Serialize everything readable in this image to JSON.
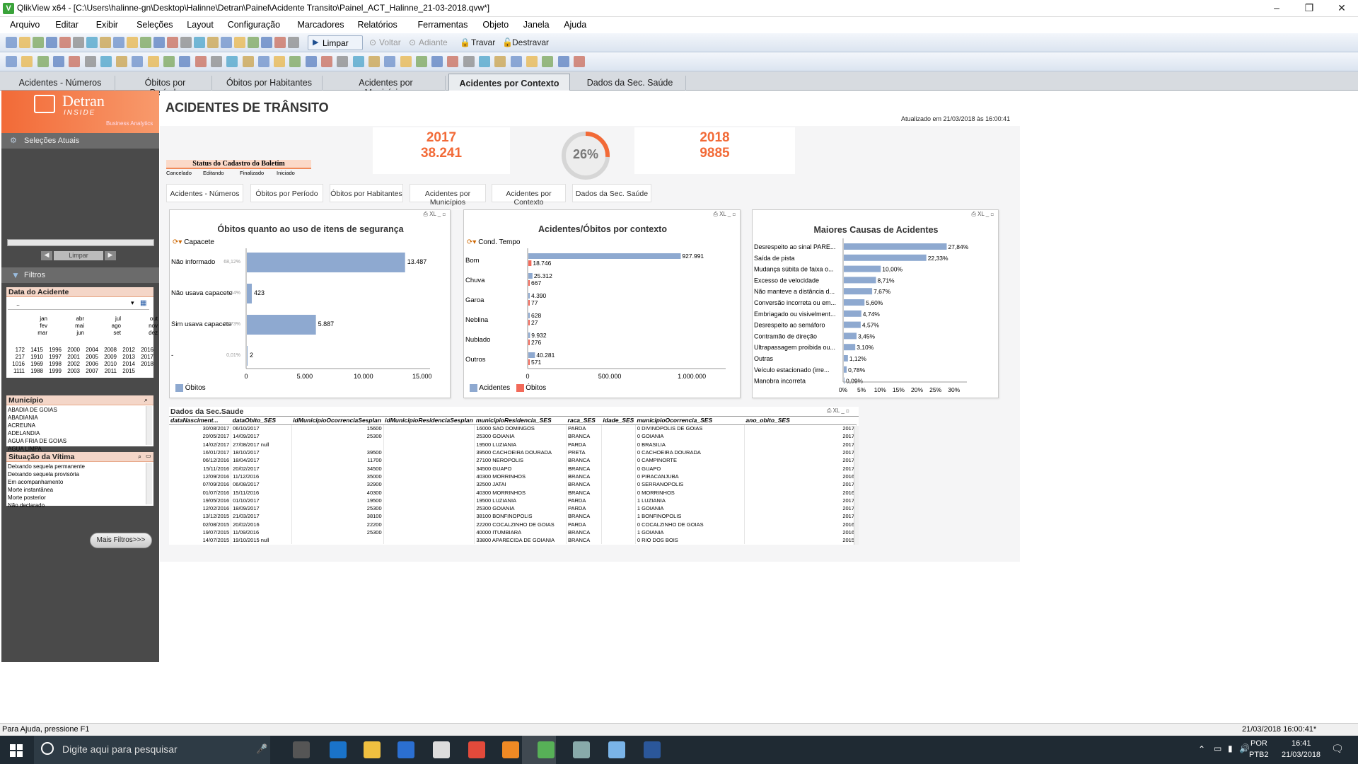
{
  "window": {
    "title": "QlikView x64 - [C:\\Users\\halinne-gn\\Desktop\\Halinne\\Detran\\Painel\\Acidente Transito\\Painel_ACT_Halinne_21-03-2018.qvw*]",
    "minimize": "–",
    "restore": "❐",
    "close": "✕"
  },
  "menu": [
    "Arquivo",
    "Editar",
    "Exibir",
    "Seleções",
    "Layout",
    "Configuração",
    "Marcadores",
    "Relatórios",
    "Ferramentas",
    "Objeto",
    "Janela",
    "Ajuda"
  ],
  "toolbar": {
    "limpar": "Limpar",
    "voltar": "Voltar",
    "adiante": "Adiante",
    "travar": "Travar",
    "destravar": "Destravar"
  },
  "tabs": [
    "Acidentes - Números",
    "Óbitos por Período",
    "Óbitos por Habitantes",
    "Acidentes por Municípios",
    "Acidentes por Contexto",
    "Dados da Sec. Saúde"
  ],
  "active_tab": "Acidentes por Contexto",
  "sidebar": {
    "logo_main": "Detran",
    "logo_sub": "INSIDE",
    "logo_tag": "Business Analytics",
    "selecoes": "Seleções Atuais",
    "limpar": "Limpar",
    "filtros": "Filtros",
    "mais_filtros": "Mais Filtros>>>"
  },
  "data_acidente": {
    "title": "Data do Acidente",
    "value": "..",
    "months": [
      [
        "jan",
        "fev",
        "mar"
      ],
      [
        "abr",
        "mai",
        "jun"
      ],
      [
        "jul",
        "ago",
        "set"
      ],
      [
        "out",
        "nov",
        "dez"
      ]
    ],
    "years": [
      [
        "172",
        "1415",
        "1996",
        "2000",
        "2004",
        "2008",
        "2012",
        "2016"
      ],
      [
        "217",
        "1910",
        "1997",
        "2001",
        "2005",
        "2009",
        "2013",
        "2017"
      ],
      [
        "1016",
        "1969",
        "1998",
        "2002",
        "2006",
        "2010",
        "2014",
        "2018"
      ],
      [
        "1111",
        "1988",
        "1999",
        "2003",
        "2007",
        "2011",
        "2015",
        ""
      ]
    ]
  },
  "municipio": {
    "title": "Município",
    "items": [
      "ABADIA DE GOIAS",
      "ABADIANIA",
      "ACREUNA",
      "ADELANDIA",
      "AGUA FRIA DE GOIAS",
      "AGUA LIMPA"
    ]
  },
  "situacao": {
    "title": "Situação da Vítima",
    "items": [
      "Deixando sequela permanente",
      "Deixando sequela provisória",
      "Em acompanhamento",
      "Morte instantânea",
      "Morte posterior",
      "Não declarado"
    ]
  },
  "header": {
    "title": "ACIDENTES DE TRÂNSITO",
    "updated": "Atualizado em 21/03/2018 às 16:00:41"
  },
  "kpi": {
    "y1": "2017",
    "v1": "38.241",
    "y2": "2018",
    "v2": "9885",
    "pct": "26%",
    "pct_value": 0.26
  },
  "status_cadastro": {
    "title": "Status do Cadastro do Boletim",
    "options": [
      "Cancelado",
      "Editando",
      "Finalizado",
      "Iniciado"
    ]
  },
  "chart1": {
    "title": "Óbitos quanto ao uso de itens de segurança",
    "dim": "Capacete",
    "legend": "Óbitos"
  },
  "chart2": {
    "title": "Acidentes/Óbitos por contexto",
    "dim": "Cond. Tempo",
    "legend_a": "Acidentes",
    "legend_b": "Óbitos"
  },
  "chart3": {
    "title": "Maiores Causas de Acidentes"
  },
  "table": {
    "title": "Dados da Sec.Saude",
    "columns": [
      "dataNasciment...",
      "dataObito_SES",
      "idMunicipioOcorrenciaSesplan",
      "idMunicipioResidenciaSesplan",
      "municipioResidencia_SES",
      "raca_SES",
      "idade_SES",
      "municipioOcorrencia_SES",
      "ano_obito_SES"
    ],
    "rows": [
      [
        "30/08/2017",
        "06/10/2017",
        "15600",
        "16000 SAO DOMINGOS",
        "PARDA",
        "0 DIVINOPOLIS DE GOIAS",
        "2017"
      ],
      [
        "20/05/2017",
        "14/09/2017",
        "25300",
        "25300 GOIANIA",
        "BRANCA",
        "0 GOIANIA",
        "2017"
      ],
      [
        "14/02/2017",
        "27/08/2017 null",
        "",
        "19500 LUZIANIA",
        "PARDA",
        "0 BRASILIA",
        "2017"
      ],
      [
        "16/01/2017",
        "18/10/2017",
        "39500",
        "39500 CACHOEIRA DOURADA",
        "PRETA",
        "0 CACHOEIRA DOURADA",
        "2017"
      ],
      [
        "06/12/2016",
        "18/04/2017",
        "11700",
        "27100 NEROPOLIS",
        "BRANCA",
        "0 CAMPINORTE",
        "2017"
      ],
      [
        "15/11/2016",
        "20/02/2017",
        "34500",
        "34500 GUAPO",
        "BRANCA",
        "0 GUAPO",
        "2017"
      ],
      [
        "12/09/2016",
        "11/12/2016",
        "35000",
        "40300 MORRINHOS",
        "BRANCA",
        "0 PIRACANJUBA",
        "2016"
      ],
      [
        "07/09/2016",
        "06/08/2017",
        "32900",
        "32500 JATAI",
        "BRANCA",
        "0 SERRANOPOLIS",
        "2017"
      ],
      [
        "01/07/2016",
        "15/11/2016",
        "40300",
        "40300 MORRINHOS",
        "BRANCA",
        "0 MORRINHOS",
        "2016"
      ],
      [
        "19/05/2016",
        "01/10/2017",
        "19500",
        "19500 LUZIANIA",
        "PARDA",
        "1 LUZIANIA",
        "2017"
      ],
      [
        "12/02/2016",
        "18/09/2017",
        "25300",
        "25300 GOIANIA",
        "PARDA",
        "1 GOIANIA",
        "2017"
      ],
      [
        "13/12/2015",
        "21/03/2017",
        "38100",
        "38100 BONFINOPOLIS",
        "BRANCA",
        "1 BONFINOPOLIS",
        "2017"
      ],
      [
        "02/08/2015",
        "20/02/2016",
        "22200",
        "22200 COCALZINHO DE GOIAS",
        "PARDA",
        "0 COCALZINHO DE GOIAS",
        "2016"
      ],
      [
        "19/07/2015",
        "11/09/2016",
        "25300",
        "40000 ITUMBIARA",
        "BRANCA",
        "1 GOIANIA",
        "2016"
      ],
      [
        "14/07/2015",
        "19/10/2015 null",
        "",
        "33800 APARECIDA DE GOIANIA",
        "BRANCA",
        "0 RIO DOS BOIS",
        "2015"
      ]
    ]
  },
  "statusbar": {
    "left": "Para Ajuda, pressione F1",
    "right": "21/03/2018 16:00:41*"
  },
  "taskbar": {
    "search": "Digite aqui para pesquisar",
    "lang": "POR",
    "kbd": "PTB2",
    "time": "16:41",
    "date": "21/03/2018"
  },
  "chart_data": [
    {
      "type": "bar",
      "title": "Óbitos quanto ao uso de itens de segurança",
      "xlabel": "",
      "ylabel": "",
      "categories": [
        "Não informado",
        "Não usava capacete",
        "Sim usava capacete",
        "-"
      ],
      "values": [
        13487,
        423,
        5887,
        2
      ],
      "percent_labels": [
        "68,12%",
        "2,14%",
        "29,73%",
        "0,01%"
      ],
      "series": [
        {
          "name": "Óbitos",
          "values": [
            13487,
            423,
            5887,
            2
          ]
        }
      ],
      "xlim": [
        0,
        17500
      ],
      "ticks": [
        "0",
        "5.000",
        "10.000",
        "15.000"
      ],
      "tick_values": [
        0,
        5000,
        10000,
        15000
      ],
      "value_labels": [
        "13.487",
        "423",
        "5.887",
        "2"
      ]
    },
    {
      "type": "bar",
      "title": "Acidentes/Óbitos por contexto",
      "categories": [
        "Bom",
        "Chuva",
        "Garoa",
        "Neblina",
        "Nublado",
        "Outros"
      ],
      "series": [
        {
          "name": "Acidentes",
          "values": [
            927991,
            25312,
            4390,
            628,
            9932,
            40281
          ],
          "labels": [
            "927.991",
            "25.312",
            "4.390",
            "628",
            "9.932",
            "40.281"
          ]
        },
        {
          "name": "Óbitos",
          "values": [
            18746,
            667,
            77,
            27,
            276,
            571
          ],
          "labels": [
            "18.746",
            "667",
            "77",
            "27",
            "276",
            "571"
          ]
        }
      ],
      "xlim": [
        0,
        1100000
      ],
      "ticks": [
        "0",
        "500.000",
        "1.000.000"
      ],
      "tick_values": [
        0,
        500000,
        1000000
      ]
    },
    {
      "type": "bar",
      "title": "Maiores Causas de Acidentes",
      "categories": [
        "Desrespeito ao sinal PARE...",
        "Saída de pista",
        "Mudança súbita de faixa o...",
        "Excesso de velocidade",
        "Não manteve a distância d...",
        "Conversão incorreta ou em...",
        "Embriagado ou visivelment...",
        "Desrespeito ao semáforo",
        "Contramão de direção",
        "Ultrapassagem proibida ou...",
        "Outras",
        "Veículo estacionado (irre...",
        "Manobra incorreta"
      ],
      "values": [
        27.84,
        22.33,
        10.0,
        8.71,
        7.67,
        5.6,
        4.74,
        4.57,
        3.45,
        3.1,
        1.12,
        0.78,
        0.09
      ],
      "value_labels": [
        "27,84%",
        "22,33%",
        "10,00%",
        "8,71%",
        "7,67%",
        "5,60%",
        "4,74%",
        "4,57%",
        "3,45%",
        "3,10%",
        "1,12%",
        "0,78%",
        "0,09%"
      ],
      "xlim": [
        0,
        32
      ],
      "ticks": [
        "0%",
        "5%",
        "10%",
        "15%",
        "20%",
        "25%",
        "30%"
      ],
      "tick_values": [
        0,
        5,
        10,
        15,
        20,
        25,
        30
      ]
    }
  ]
}
